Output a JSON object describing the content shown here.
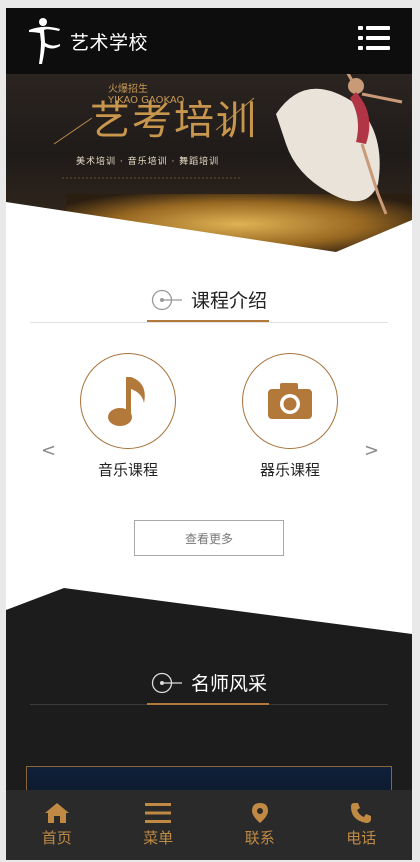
{
  "header": {
    "logo_text": "艺术学校",
    "menu_icon": "menu-icon"
  },
  "banner": {
    "small_line1": "火爆招生",
    "small_line2": "YIKAO GAOKAO",
    "title": "艺考培训",
    "subtitle": "美术培训 · 音乐培训 · 舞蹈培训"
  },
  "courses_section": {
    "title": "课程介绍",
    "items": [
      {
        "label": "音乐课程",
        "icon": "music-note-icon"
      },
      {
        "label": "器乐课程",
        "icon": "camera-icon"
      }
    ],
    "prev": "<",
    "next": ">",
    "more_label": "查看更多"
  },
  "teachers_section": {
    "title": "名师风采"
  },
  "bottom_nav": [
    {
      "label": "首页",
      "icon": "home-icon"
    },
    {
      "label": "菜单",
      "icon": "menu-icon"
    },
    {
      "label": "联系",
      "icon": "location-pin-icon"
    },
    {
      "label": "电话",
      "icon": "phone-icon"
    }
  ],
  "colors": {
    "accent": "#b3793b",
    "header_bg": "#0d0d0d",
    "dark_bg": "#1c1c1c",
    "nav_bg": "#2a2a2a"
  }
}
